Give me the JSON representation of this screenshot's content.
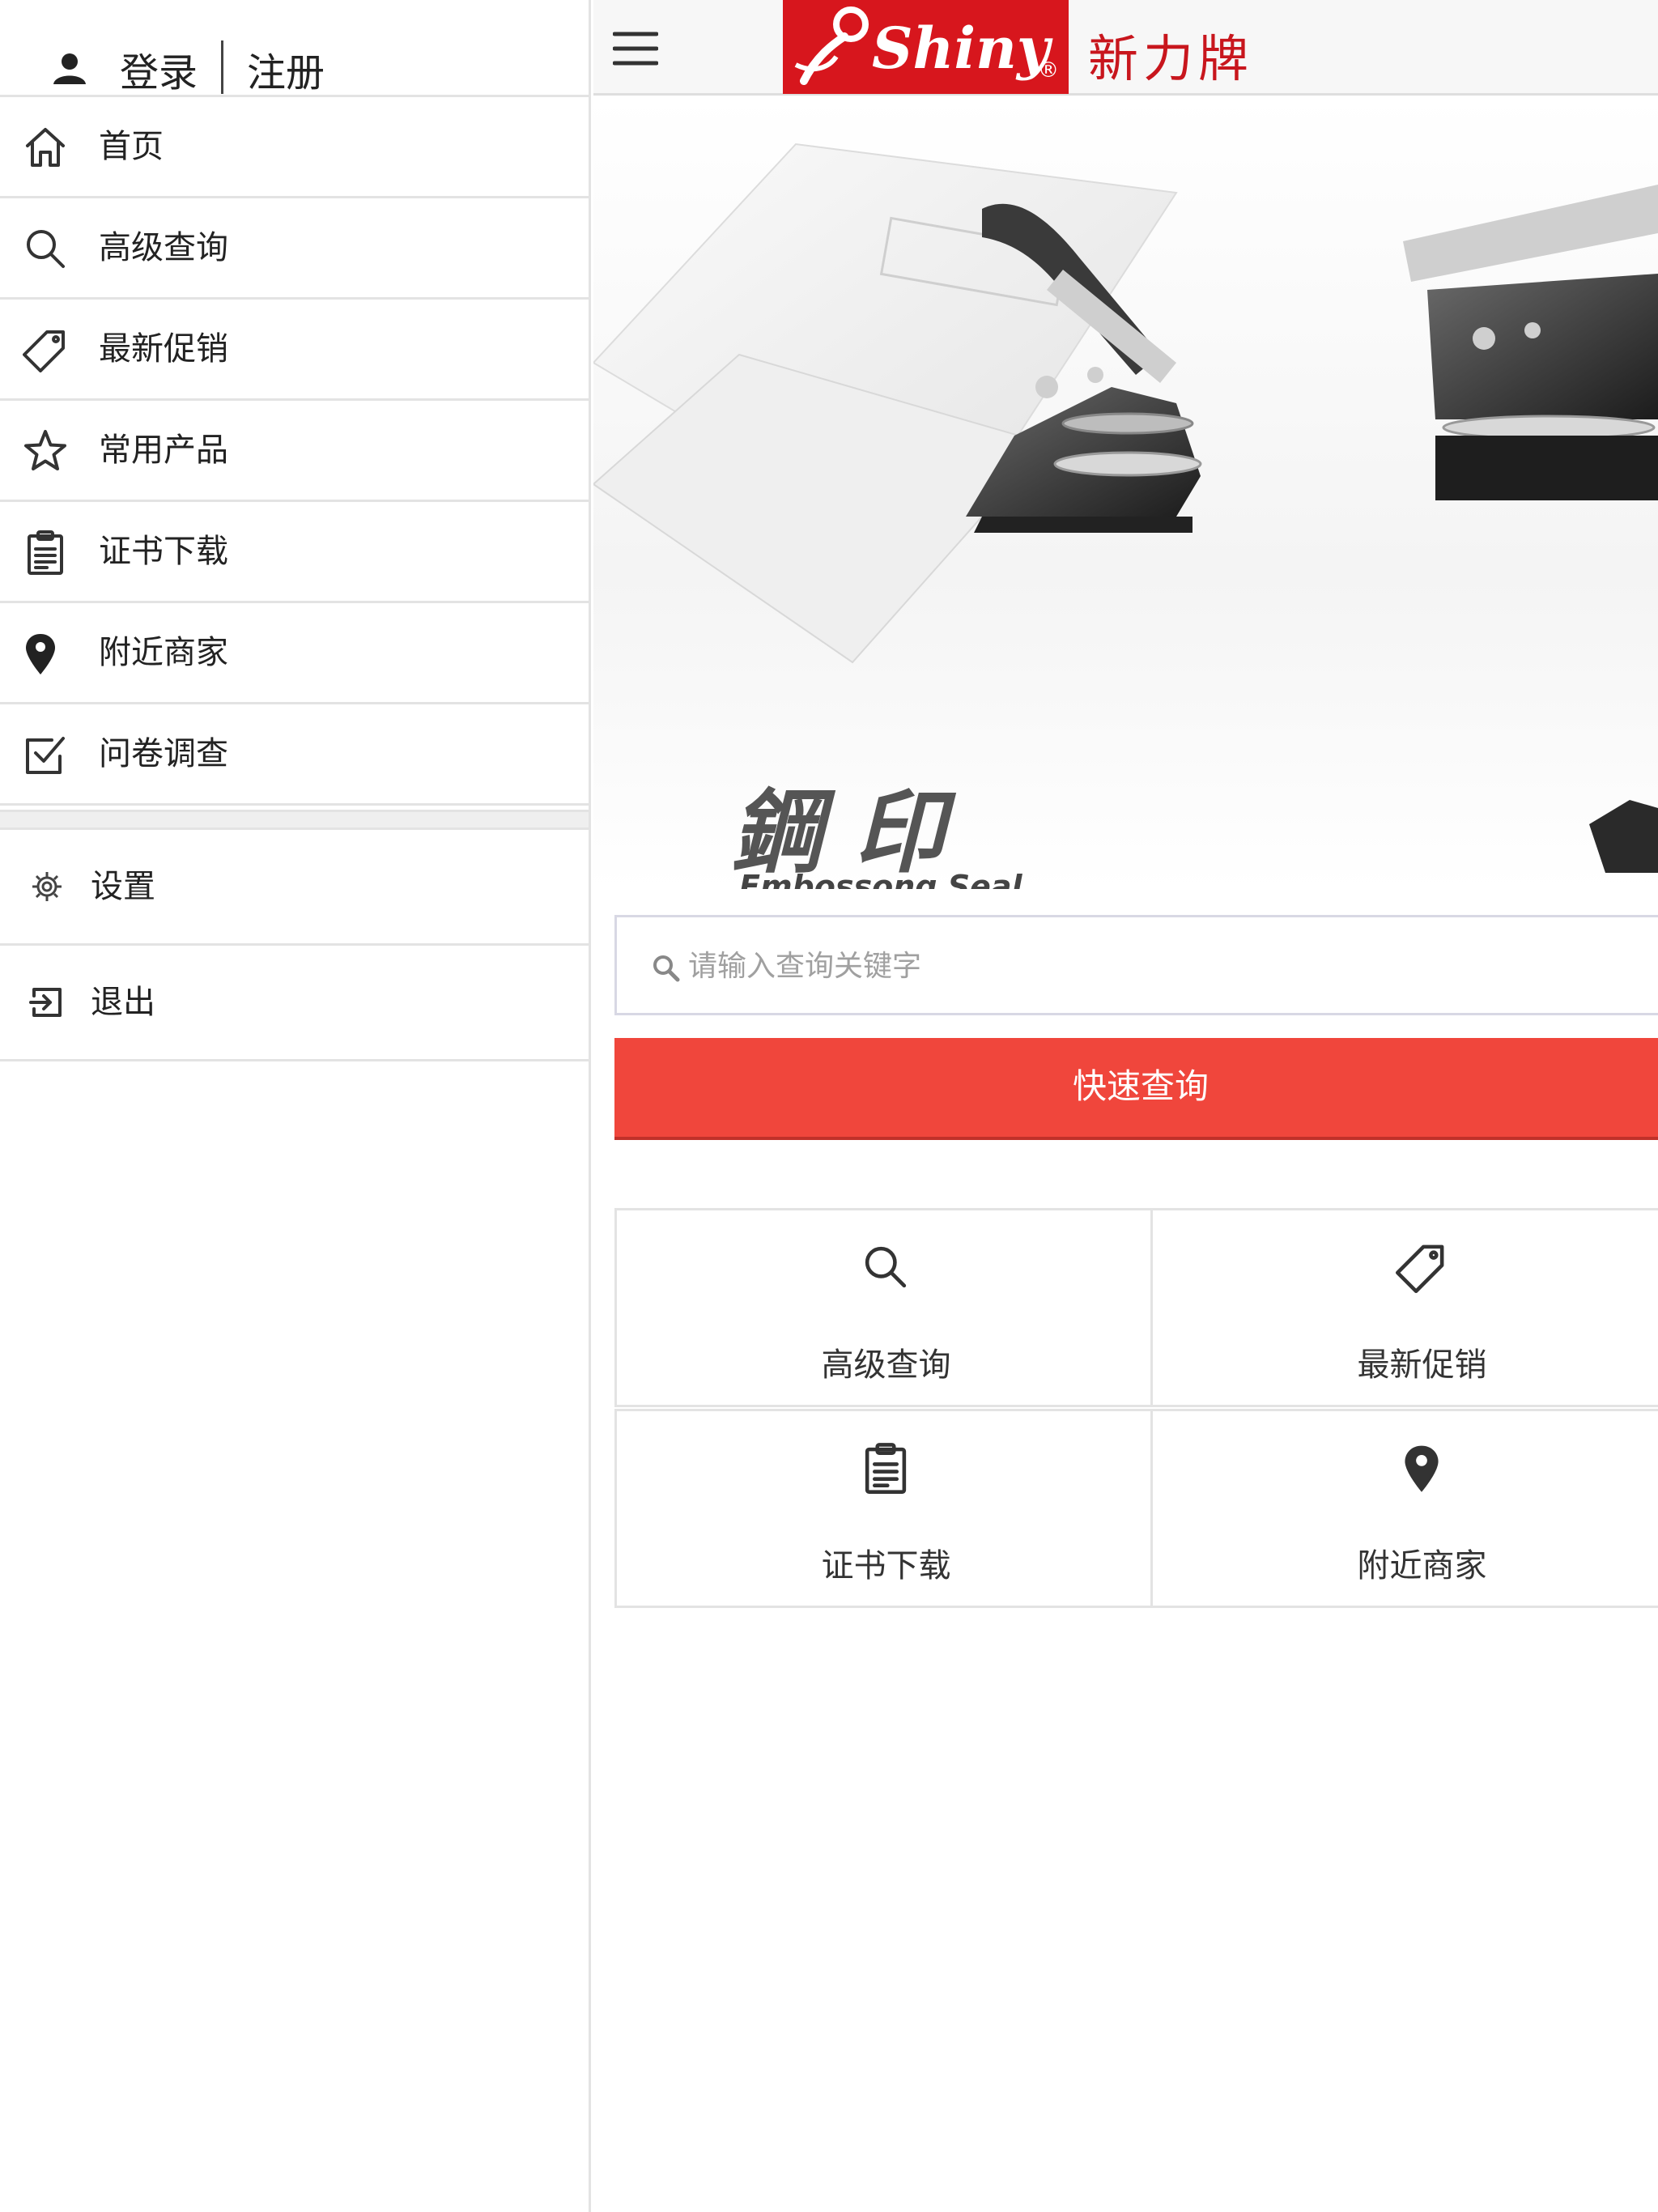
{
  "sidebar": {
    "auth": {
      "login": "登录",
      "register": "注册"
    },
    "menu": [
      {
        "label": "首页",
        "icon": "home-icon"
      },
      {
        "label": "高级查询",
        "icon": "search-icon"
      },
      {
        "label": "最新促销",
        "icon": "tag-icon"
      },
      {
        "label": "常用产品",
        "icon": "star-icon"
      },
      {
        "label": "证书下载",
        "icon": "clipboard-icon"
      },
      {
        "label": "附近商家",
        "icon": "map-pin-icon"
      },
      {
        "label": "问卷调查",
        "icon": "checkbox-icon"
      }
    ],
    "secondary": [
      {
        "label": "设置",
        "icon": "gear-icon"
      },
      {
        "label": "退出",
        "icon": "logout-icon"
      }
    ]
  },
  "header": {
    "logo_text": "Shiny",
    "logo_reg": "®",
    "brand_cn": "新力牌"
  },
  "banner": {
    "title_cn": "鋼印",
    "title_en": "Embossong Seal"
  },
  "search": {
    "placeholder": "请输入查询关键字"
  },
  "quick_search": {
    "label": "快速查询"
  },
  "tiles": [
    {
      "label": "高级查询",
      "icon": "search-icon"
    },
    {
      "label": "最新促销",
      "icon": "tag-icon"
    },
    {
      "label": "证书下载",
      "icon": "clipboard-icon"
    },
    {
      "label": "附近商家",
      "icon": "map-pin-icon"
    }
  ],
  "colors": {
    "brand_red": "#d7161d",
    "button_red": "#f0463c"
  }
}
